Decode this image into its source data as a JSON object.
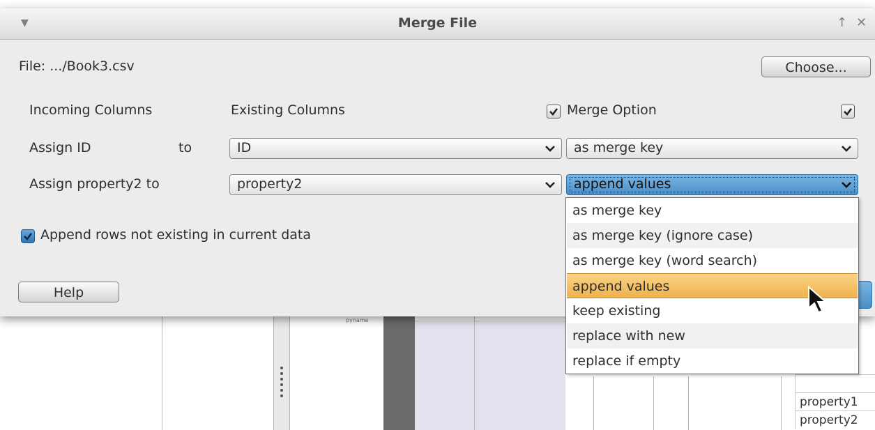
{
  "dialog": {
    "title": "Merge File",
    "file_label": "File: .../Book3.csv",
    "choose_button": "Choose...",
    "header": {
      "incoming": "Incoming Columns",
      "existing": "Existing Columns",
      "merge_option": "Merge Option"
    },
    "rows": [
      {
        "assign_label": "Assign ID",
        "to": "to",
        "existing_value": "ID",
        "merge_value": "as merge key"
      },
      {
        "assign_label": "Assign property2 to",
        "existing_value": "property2",
        "merge_value": "append values"
      }
    ],
    "append_rows_label": "Append rows not existing in current data",
    "append_rows_checked": true,
    "help_button": "Help"
  },
  "merge_dropdown": {
    "options": [
      "as merge key",
      "as merge key (ignore case)",
      "as merge key (word search)",
      "append values",
      "keep existing",
      "replace with new",
      "replace if empty"
    ],
    "highlighted": "append values"
  },
  "background": {
    "tiny_label": "pyname",
    "properties": [
      "property1",
      "property2"
    ]
  },
  "colors": {
    "accent_blue": "#4a8ec8",
    "highlight_orange": "#f4bd5f",
    "dialog_bg": "#ececec"
  }
}
